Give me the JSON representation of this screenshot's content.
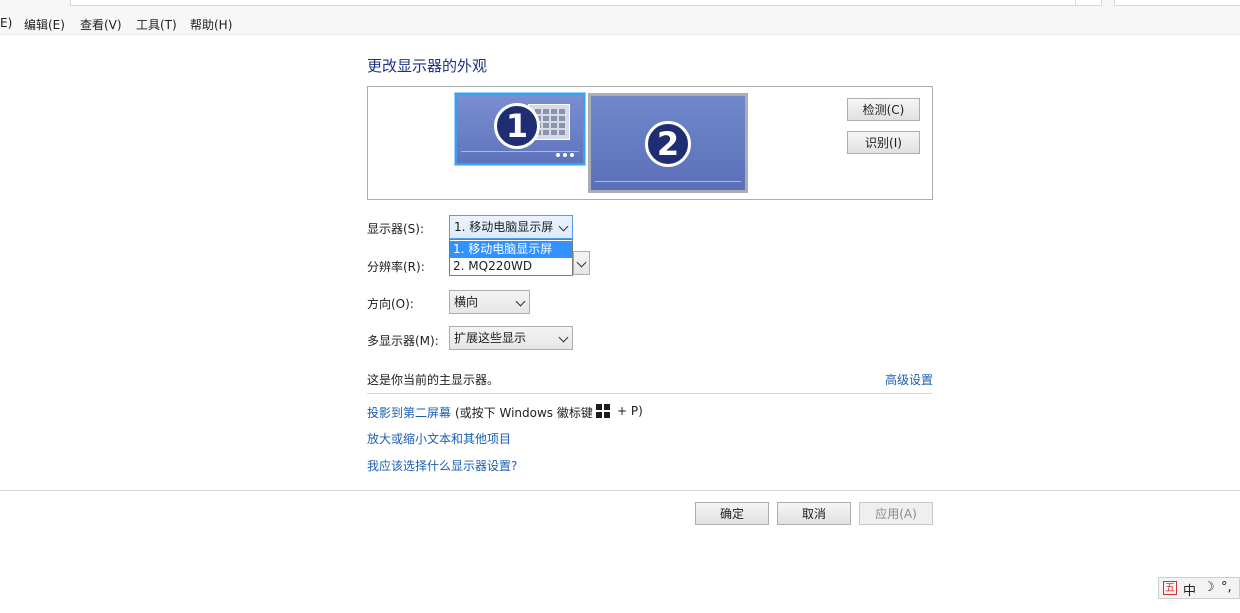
{
  "menu": {
    "items": [
      {
        "label": "E)"
      },
      {
        "label": "编辑(E)"
      },
      {
        "label": "查看(V)"
      },
      {
        "label": "工具(T)"
      },
      {
        "label": "帮助(H)"
      }
    ]
  },
  "page": {
    "title": "更改显示器的外观"
  },
  "preview": {
    "monitor1": "1",
    "monitor2": "2",
    "detect_label": "检测(C)",
    "identify_label": "识别(I)"
  },
  "settings": {
    "display_label": "显示器(S):",
    "display_value": "1. 移动电脑显示屏",
    "display_options": [
      "1. 移动电脑显示屏",
      "2. MQ220WD"
    ],
    "resolution_label": "分辨率(R):",
    "orientation_label": "方向(O):",
    "orientation_value": "横向",
    "multi_label": "多显示器(M):",
    "multi_value": "扩展这些显示",
    "status_text": "这是你当前的主显示器。",
    "advanced_link": "高级设置"
  },
  "links": {
    "project_link": "投影到第二屏幕",
    "project_hint": "(或按下 Windows 徽标键",
    "project_hint_tail": "+ P)",
    "text_size_link": "放大或缩小文本和其他项目",
    "which_setting_link": "我应该选择什么显示器设置?"
  },
  "buttons": {
    "ok": "确定",
    "cancel": "取消",
    "apply": "应用(A)"
  },
  "ime": {
    "logo": "五",
    "mode": "中",
    "moon": "☽",
    "punct": "°,"
  },
  "colors": {
    "title": "#1e3287",
    "link": "#1a5fb4",
    "selection": "#3390ff"
  }
}
